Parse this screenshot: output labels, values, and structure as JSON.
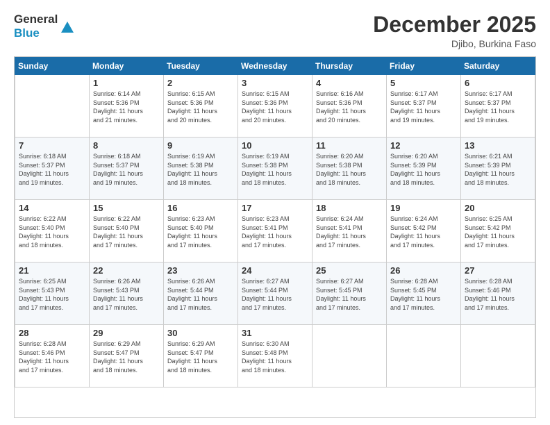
{
  "logo": {
    "line1": "General",
    "line2": "Blue"
  },
  "title": "December 2025",
  "location": "Djibo, Burkina Faso",
  "days_header": [
    "Sunday",
    "Monday",
    "Tuesday",
    "Wednesday",
    "Thursday",
    "Friday",
    "Saturday"
  ],
  "weeks": [
    [
      {
        "day": "",
        "info": ""
      },
      {
        "day": "1",
        "info": "Sunrise: 6:14 AM\nSunset: 5:36 PM\nDaylight: 11 hours\nand 21 minutes."
      },
      {
        "day": "2",
        "info": "Sunrise: 6:15 AM\nSunset: 5:36 PM\nDaylight: 11 hours\nand 20 minutes."
      },
      {
        "day": "3",
        "info": "Sunrise: 6:15 AM\nSunset: 5:36 PM\nDaylight: 11 hours\nand 20 minutes."
      },
      {
        "day": "4",
        "info": "Sunrise: 6:16 AM\nSunset: 5:36 PM\nDaylight: 11 hours\nand 20 minutes."
      },
      {
        "day": "5",
        "info": "Sunrise: 6:17 AM\nSunset: 5:37 PM\nDaylight: 11 hours\nand 19 minutes."
      },
      {
        "day": "6",
        "info": "Sunrise: 6:17 AM\nSunset: 5:37 PM\nDaylight: 11 hours\nand 19 minutes."
      }
    ],
    [
      {
        "day": "7",
        "info": "Sunrise: 6:18 AM\nSunset: 5:37 PM\nDaylight: 11 hours\nand 19 minutes."
      },
      {
        "day": "8",
        "info": "Sunrise: 6:18 AM\nSunset: 5:37 PM\nDaylight: 11 hours\nand 19 minutes."
      },
      {
        "day": "9",
        "info": "Sunrise: 6:19 AM\nSunset: 5:38 PM\nDaylight: 11 hours\nand 18 minutes."
      },
      {
        "day": "10",
        "info": "Sunrise: 6:19 AM\nSunset: 5:38 PM\nDaylight: 11 hours\nand 18 minutes."
      },
      {
        "day": "11",
        "info": "Sunrise: 6:20 AM\nSunset: 5:38 PM\nDaylight: 11 hours\nand 18 minutes."
      },
      {
        "day": "12",
        "info": "Sunrise: 6:20 AM\nSunset: 5:39 PM\nDaylight: 11 hours\nand 18 minutes."
      },
      {
        "day": "13",
        "info": "Sunrise: 6:21 AM\nSunset: 5:39 PM\nDaylight: 11 hours\nand 18 minutes."
      }
    ],
    [
      {
        "day": "14",
        "info": "Sunrise: 6:22 AM\nSunset: 5:40 PM\nDaylight: 11 hours\nand 18 minutes."
      },
      {
        "day": "15",
        "info": "Sunrise: 6:22 AM\nSunset: 5:40 PM\nDaylight: 11 hours\nand 17 minutes."
      },
      {
        "day": "16",
        "info": "Sunrise: 6:23 AM\nSunset: 5:40 PM\nDaylight: 11 hours\nand 17 minutes."
      },
      {
        "day": "17",
        "info": "Sunrise: 6:23 AM\nSunset: 5:41 PM\nDaylight: 11 hours\nand 17 minutes."
      },
      {
        "day": "18",
        "info": "Sunrise: 6:24 AM\nSunset: 5:41 PM\nDaylight: 11 hours\nand 17 minutes."
      },
      {
        "day": "19",
        "info": "Sunrise: 6:24 AM\nSunset: 5:42 PM\nDaylight: 11 hours\nand 17 minutes."
      },
      {
        "day": "20",
        "info": "Sunrise: 6:25 AM\nSunset: 5:42 PM\nDaylight: 11 hours\nand 17 minutes."
      }
    ],
    [
      {
        "day": "21",
        "info": "Sunrise: 6:25 AM\nSunset: 5:43 PM\nDaylight: 11 hours\nand 17 minutes."
      },
      {
        "day": "22",
        "info": "Sunrise: 6:26 AM\nSunset: 5:43 PM\nDaylight: 11 hours\nand 17 minutes."
      },
      {
        "day": "23",
        "info": "Sunrise: 6:26 AM\nSunset: 5:44 PM\nDaylight: 11 hours\nand 17 minutes."
      },
      {
        "day": "24",
        "info": "Sunrise: 6:27 AM\nSunset: 5:44 PM\nDaylight: 11 hours\nand 17 minutes."
      },
      {
        "day": "25",
        "info": "Sunrise: 6:27 AM\nSunset: 5:45 PM\nDaylight: 11 hours\nand 17 minutes."
      },
      {
        "day": "26",
        "info": "Sunrise: 6:28 AM\nSunset: 5:45 PM\nDaylight: 11 hours\nand 17 minutes."
      },
      {
        "day": "27",
        "info": "Sunrise: 6:28 AM\nSunset: 5:46 PM\nDaylight: 11 hours\nand 17 minutes."
      }
    ],
    [
      {
        "day": "28",
        "info": "Sunrise: 6:28 AM\nSunset: 5:46 PM\nDaylight: 11 hours\nand 17 minutes."
      },
      {
        "day": "29",
        "info": "Sunrise: 6:29 AM\nSunset: 5:47 PM\nDaylight: 11 hours\nand 18 minutes."
      },
      {
        "day": "30",
        "info": "Sunrise: 6:29 AM\nSunset: 5:47 PM\nDaylight: 11 hours\nand 18 minutes."
      },
      {
        "day": "31",
        "info": "Sunrise: 6:30 AM\nSunset: 5:48 PM\nDaylight: 11 hours\nand 18 minutes."
      },
      {
        "day": "",
        "info": ""
      },
      {
        "day": "",
        "info": ""
      },
      {
        "day": "",
        "info": ""
      }
    ]
  ]
}
